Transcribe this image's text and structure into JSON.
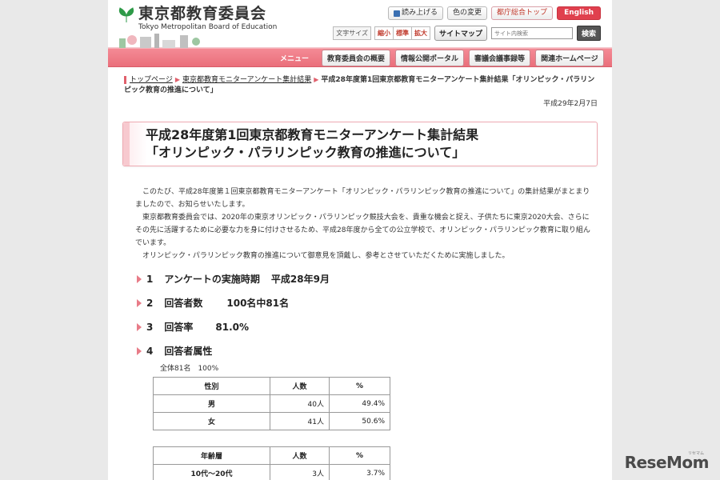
{
  "header": {
    "logo_jp": "東京都教育委員会",
    "logo_en": "Tokyo Metropolitan Board of Education",
    "buttons": {
      "read_aloud": "読み上げる",
      "color_change": "色の変更",
      "tocho_top": "都庁総合トップ",
      "english": "English"
    },
    "font_size_label": "文字サイズ",
    "font_sizes": [
      "縮小",
      "標準",
      "拡大"
    ],
    "sitemap": "サイトマップ",
    "search_placeholder": "サイト内検索",
    "search_button": "検索"
  },
  "nav": {
    "menu_label": "メニュー",
    "items": [
      "教育委員会の概要",
      "情報公開ポータル",
      "審議会議事録等",
      "関連ホームページ"
    ]
  },
  "breadcrumb": {
    "items": [
      "トップページ",
      "東京都教育モニターアンケート集計結果"
    ],
    "current": "平成28年度第1回東京都教育モニターアンケート集計結果「オリンピック・パラリンピック教育の推進について」"
  },
  "date": "平成29年2月7日",
  "title": {
    "line1": "平成28年度第1回東京都教育モニターアンケート集計結果",
    "line2": "「オリンピック・パラリンピック教育の推進について」"
  },
  "intro": [
    "このたび、平成28年度第１回東京都教育モニターアンケート「オリンピック・パラリンピック教育の推進について」の集計結果がまとまりましたので、お知らせいたします。",
    "東京都教育委員会では、2020年の東京オリンピック・パラリンピック競技大会を、貴重な機会と捉え、子供たちに東京2020大会、さらにその先に活躍するために必要な力を身に付けさせるため、平成28年度から全ての公立学校で、オリンピック・パラリンピック教育に取り組んでいます。",
    "オリンピック・パラリンピック教育の推進について御意見を頂戴し、参考とさせていただくために実施しました。"
  ],
  "sections": [
    {
      "num": "1",
      "label": "アンケートの実施時期",
      "value": "平成28年9月"
    },
    {
      "num": "2",
      "label": "回答者数",
      "value": "100名中81名"
    },
    {
      "num": "3",
      "label": "回答率",
      "value": "81.0%"
    },
    {
      "num": "4",
      "label": "回答者属性",
      "value": ""
    }
  ],
  "total": "全体81名　100%",
  "gender_table": {
    "headers": [
      "性別",
      "人数",
      "%"
    ],
    "rows": [
      [
        "男",
        "40人",
        "49.4%"
      ],
      [
        "女",
        "41人",
        "50.6%"
      ]
    ]
  },
  "age_table": {
    "headers": [
      "年齢層",
      "人数",
      "%"
    ],
    "rows": [
      [
        "10代〜20代",
        "3人",
        "3.7%"
      ]
    ]
  },
  "watermark": "ReseMom",
  "watermark_small": "リセマム"
}
